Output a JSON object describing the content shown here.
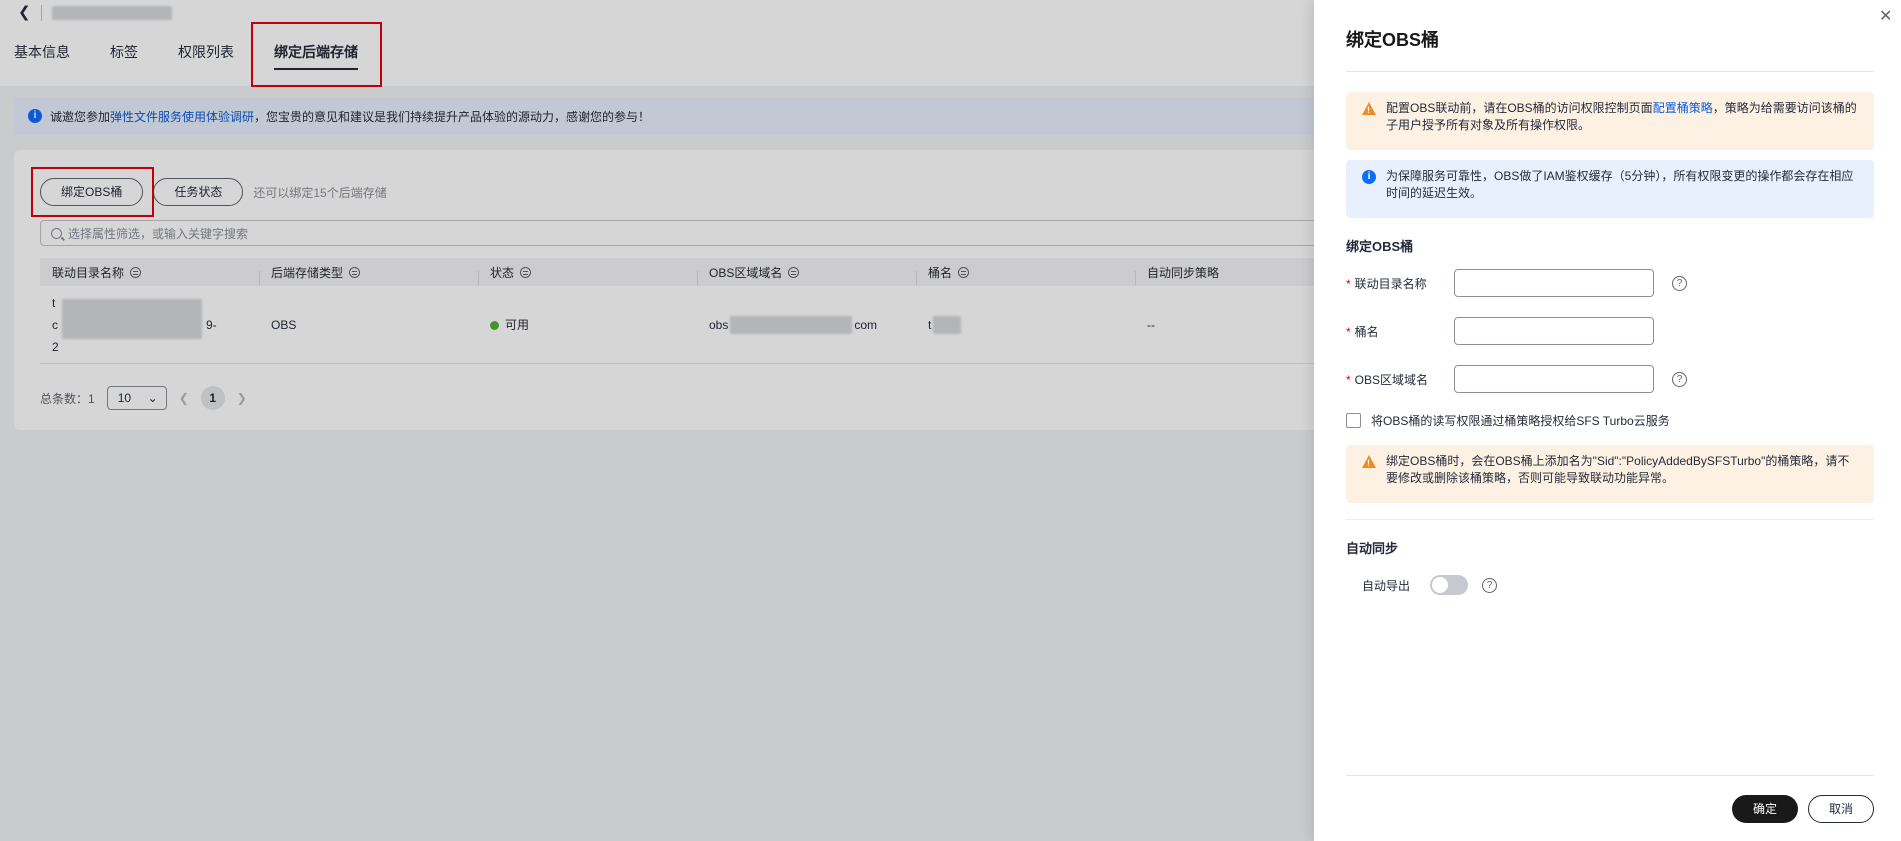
{
  "tabs": [
    "基本信息",
    "标签",
    "权限列表",
    "绑定后端存储"
  ],
  "notice": {
    "prefix": "诚邀您参加",
    "link": "弹性文件服务使用体验调研",
    "suffix": "，您宝贵的意见和建议是我们持续提升产品体验的源动力，感谢您的参与！"
  },
  "toolbar": {
    "bind_button": "绑定OBS桶",
    "task_button": "任务状态",
    "hint": "还可以绑定15个后端存储"
  },
  "search": {
    "placeholder": "选择属性筛选，或输入关键字搜索"
  },
  "table": {
    "headers": [
      "联动目录名称",
      "后端存储类型",
      "状态",
      "OBS区域域名",
      "桶名",
      "自动同步策略"
    ],
    "row": {
      "name_start": "t",
      "name_mid": "c",
      "name_end": "2",
      "name_frag": "9-",
      "type": "OBS",
      "status": "可用",
      "domain_prefix": "obs",
      "domain_suffix": "com",
      "bucket_prefix": "t",
      "bucket_suffix": "",
      "sync": "--"
    }
  },
  "pagination": {
    "total_label": "总条数：1",
    "page_size": "10",
    "current_page": "1"
  },
  "drawer": {
    "title": "绑定OBS桶",
    "warn1": {
      "prefix": "配置OBS联动前，请在OBS桶的访问权限控制页面",
      "link": "配置桶策略",
      "suffix": "，策略为给需要访问该桶的子用户授予所有对象及所有操作权限。"
    },
    "info": "为保障服务可靠性，OBS做了IAM鉴权缓存（5分钟），所有权限变更的操作都会存在相应时间的延迟生效。",
    "section_title": "绑定OBS桶",
    "fields": {
      "dir_label": "联动目录名称",
      "bucket_label": "桶名",
      "domain_label": "OBS区域域名"
    },
    "checkbox_label": "将OBS桶的读写权限通过桶策略授权给SFS Turbo云服务",
    "warn2": "绑定OBS桶时，会在OBS桶上添加名为\"Sid\":\"PolicyAddedBySFSTurbo\"的桶策略，请不要修改或删除该桶策略，否则可能导致联动功能异常。",
    "auto_sync_title": "自动同步",
    "auto_export_label": "自动导出",
    "auto_export_on": false,
    "confirm": "确定",
    "cancel": "取消"
  }
}
